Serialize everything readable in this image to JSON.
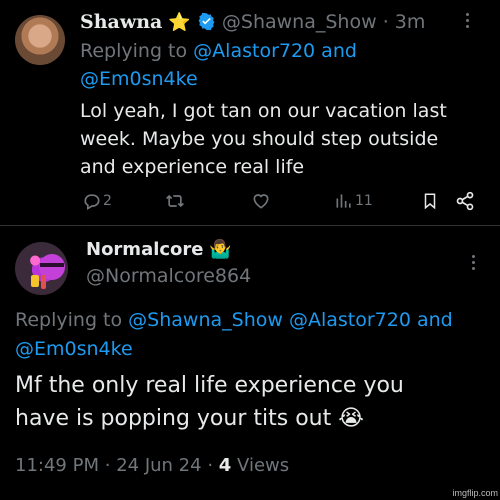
{
  "tweet1": {
    "display_name": "Shawna",
    "handle": "@Shawna_Show",
    "separator": "·",
    "time_ago": "3m",
    "replying_to_label": "Replying to",
    "replying_to_users": "@Alastor720 and",
    "replying_to_users_line2": "@Em0sn4ke",
    "text_line1": "Lol yeah, I got tan on our vacation last",
    "text_line2": "week. Maybe you should step outside",
    "text_line3": "and experience real life",
    "reply_count": "2",
    "views_count": "11"
  },
  "tweet2": {
    "display_name": "Normalcore",
    "emoji": "🤷‍♂️",
    "handle": "@Normalcore864",
    "replying_to_label": "Replying to",
    "replying_to_users": "@Shawna_Show @Alastor720 and",
    "replying_to_users_line2": "@Em0sn4ke",
    "text_line1": "Mf the only real life experience you",
    "text_line2": "have is popping your tits out",
    "text_emoji": "😭",
    "time": "11:49 PM",
    "date": "24 Jun 24",
    "separator": "·",
    "views_count": "4",
    "views_label": "Views"
  },
  "watermark": "imgflip.com",
  "colors": {
    "background": "#000000",
    "text": "#e7e9ea",
    "muted": "#71767b",
    "link": "#1d9bf0",
    "verified": "#1d9bf0"
  }
}
